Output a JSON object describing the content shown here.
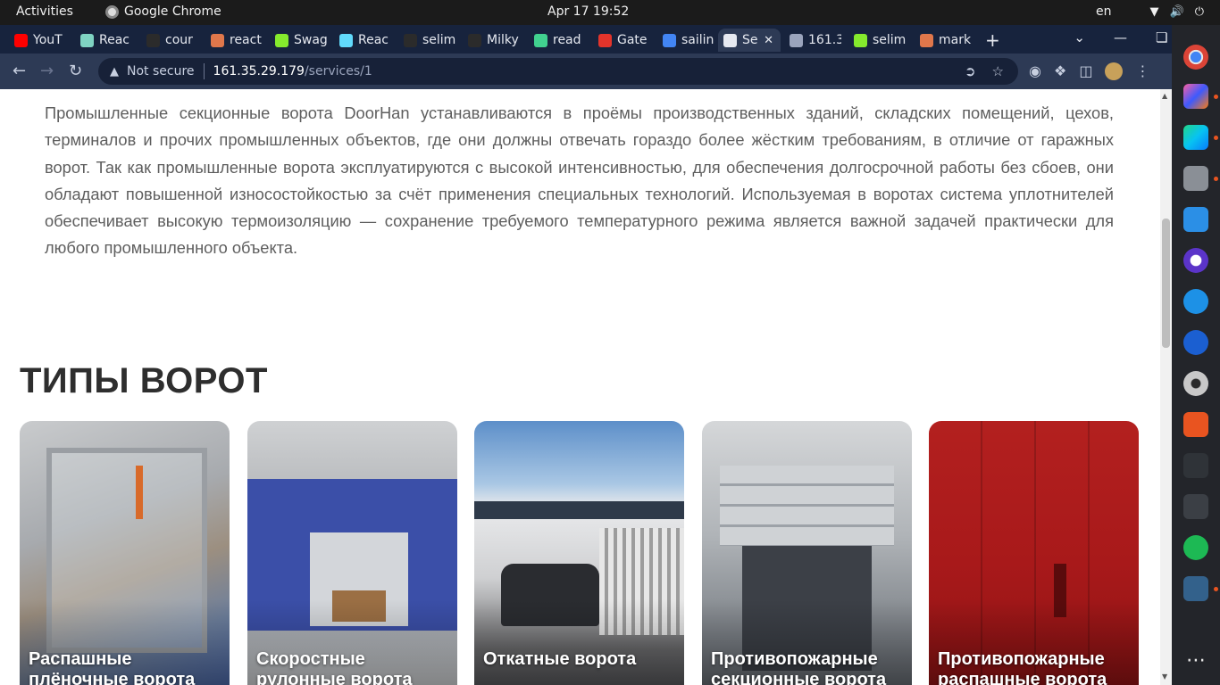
{
  "system": {
    "activities": "Activities",
    "app_name": "Google Chrome",
    "clock": "Apr 17  19:52",
    "language": "en"
  },
  "tabs": [
    {
      "label": "YouT",
      "color": "#ff0000"
    },
    {
      "label": "Reac",
      "color": "#7fd3c2"
    },
    {
      "label": "cour",
      "color": "#2b2b2b"
    },
    {
      "label": "react",
      "color": "#e0774b"
    },
    {
      "label": "Swag",
      "color": "#85ea2d"
    },
    {
      "label": "Reac",
      "color": "#61dafb"
    },
    {
      "label": "selim",
      "color": "#2b2b2b"
    },
    {
      "label": "Milky",
      "color": "#2b2b2b"
    },
    {
      "label": "read",
      "color": "#41d18f"
    },
    {
      "label": "Gate",
      "color": "#e4342b"
    },
    {
      "label": "sailin",
      "color": "#4285f4"
    },
    {
      "label": "Se",
      "color": "#e6e9f0",
      "active": true
    },
    {
      "label": "161.3",
      "color": "#9aa4bc"
    },
    {
      "label": "selim",
      "color": "#85ea2d"
    },
    {
      "label": "mark",
      "color": "#e0774b"
    }
  ],
  "toolbar": {
    "security_label": "Not secure",
    "url_host": "161.35.29.179",
    "url_path": "/services/1"
  },
  "page": {
    "intro": "Промышленные секционные ворота DoorHan устанавливаются в проёмы производственных зданий, складских помещений, цехов, терминалов и прочих промышленных объектов, где они должны отвечать гораздо более жёстким требованиям, в отличие от гаражных ворот. Так как промышленные ворота эксплуатируются с высокой интенсивностью, для обеспечения долгосрочной работы без сбоев, они обладают повышенной износостойкостью за счёт применения специальных технологий. Используемая в воротах система уплотнителей обеспечивает высокую термоизоляцию — сохранение требуемого температурного режима является важной задачей практически для любого промышленного объекта.",
    "types_title": "ТИПЫ ВОРОТ",
    "cards": [
      {
        "title": "Распашные плёночные ворота"
      },
      {
        "title": "Скоростные рулонные ворота"
      },
      {
        "title": "Откатные ворота"
      },
      {
        "title": "Противопожарные секционные ворота"
      },
      {
        "title": "Противопожарные распашные ворота"
      }
    ]
  }
}
